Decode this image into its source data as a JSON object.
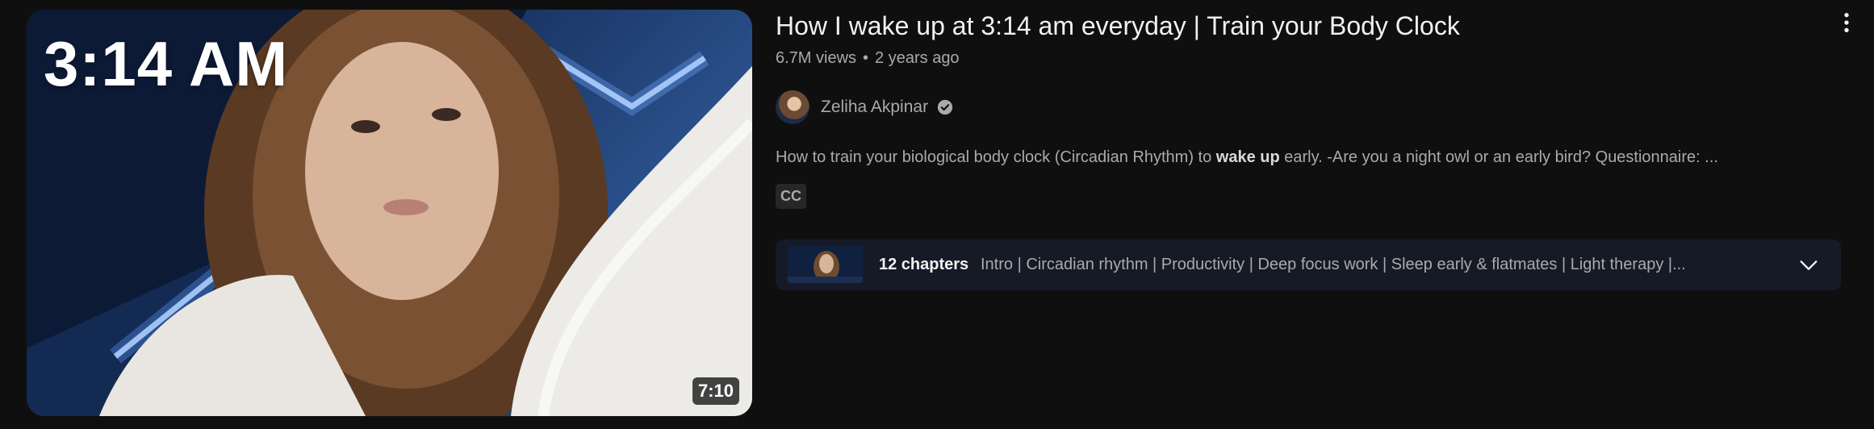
{
  "video": {
    "thumbnail_overlay_text": "3:14 AM",
    "duration": "7:10",
    "title": "How I wake up at 3:14 am everyday | Train your Body Clock",
    "views": "6.7M views",
    "meta_separator": "•",
    "age": "2 years ago",
    "channel": {
      "name": "Zeliha Akpinar",
      "verified_icon": "verified-check-icon"
    },
    "description": {
      "before": "How to train your biological body clock (Circadian Rhythm) to ",
      "bold": "wake up",
      "after": " early. -Are you a night owl or an early bird? Questionnaire: ..."
    },
    "badge": "CC",
    "chapters": {
      "count_label": "12 chapters",
      "list": "Intro | Circadian rhythm | Productivity | Deep focus work | Sleep early & flatmates | Light therapy |..."
    }
  },
  "icons": {
    "menu": "kebab-menu-icon",
    "expand": "chevron-down-icon"
  },
  "colors": {
    "background": "#0f0f0f",
    "title": "#f1f1f1",
    "secondary_text": "#aaaaaa",
    "chapters_bg": "#151a26"
  }
}
